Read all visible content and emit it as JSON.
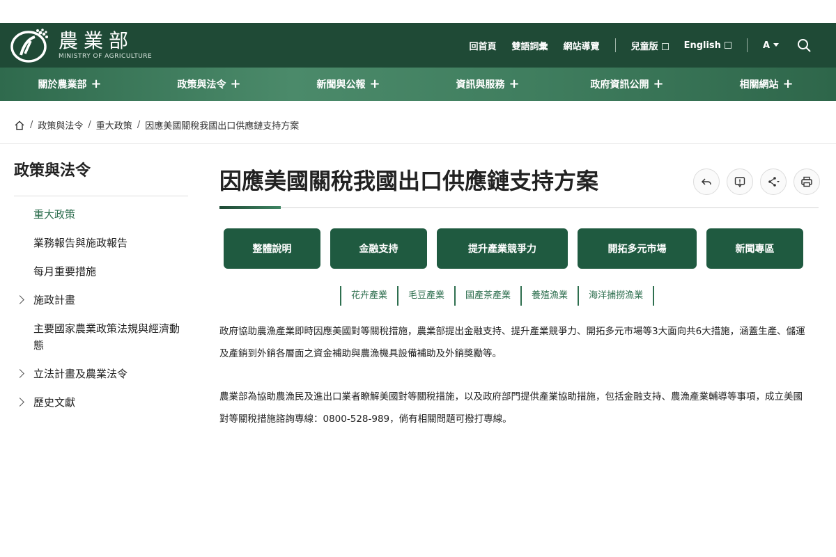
{
  "header": {
    "logo_zh": "農業部",
    "logo_en": "MINISTRY OF AGRICULTURE",
    "links": {
      "home": "回首頁",
      "glossary": "雙語詞彙",
      "sitemap": "網站導覽",
      "kids": "兒童版",
      "english": "English",
      "font_size": "A"
    }
  },
  "nav": {
    "items": [
      "關於農業部",
      "政策與法令",
      "新聞與公報",
      "資訊與服務",
      "政府資訊公開",
      "相關網站"
    ],
    "plus": "+"
  },
  "breadcrumb": {
    "sep": "/",
    "items": [
      "政策與法令",
      "重大政策",
      "因應美國關稅我國出口供應鏈支持方案"
    ]
  },
  "sidebar": {
    "title": "政策與法令",
    "items": [
      {
        "label": "重大政策"
      },
      {
        "label": "業務報告與施政報告"
      },
      {
        "label": "每月重要措施"
      },
      {
        "label": "施政計畫"
      },
      {
        "label": "主要國家農業政策法規與經濟動態"
      },
      {
        "label": "立法計畫及農業法令"
      },
      {
        "label": "歷史文獻"
      }
    ]
  },
  "main": {
    "title": "因應美國關稅我國出口供應鏈支持方案",
    "tabs": [
      "整體說明",
      "金融支持",
      "提升產業競爭力",
      "開拓多元市場",
      "新聞專區"
    ],
    "subtags": [
      "花卉產業",
      "毛豆產業",
      "國產茶產業",
      "養殖漁業",
      "海洋捕撈漁業"
    ],
    "paragraph1": "政府協助農漁產業即時因應美國對等關稅措施，農業部提出金融支持、提升產業競爭力、開拓多元市場等3大面向共6大措施，涵蓋生產、儲運及產銷到外銷各層面之資金補助與農漁機具設備補助及外銷獎勵等。",
    "paragraph2": "農業部為協助農漁民及進出口業者瞭解美國對等關稅措施，以及政府部門提供產業協助措施，包括金融支持、農漁產業輔導等事項，成立美國對等關稅措施諮詢專線：0800-528-989，倘有相關問題可撥打專線。"
  },
  "colors": {
    "header_bg": "#1f4a36",
    "nav_bg": "#3f7d5e",
    "accent": "#1f5a40",
    "active_text": "#2e6f4f"
  }
}
